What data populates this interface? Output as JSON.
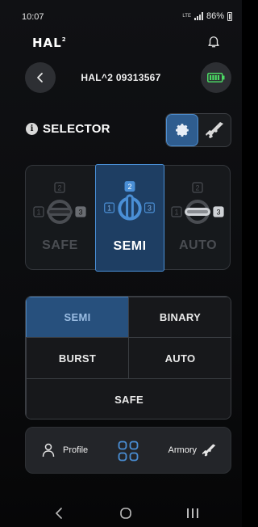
{
  "status_bar": {
    "time": "10:07",
    "network": "LTE",
    "battery": "86%"
  },
  "header": {
    "logo": "HAL",
    "logo_sup": "2"
  },
  "device": {
    "name": "HAL^2 09313567"
  },
  "selector": {
    "title": "SELECTOR",
    "positions": [
      {
        "label": "SAFE",
        "numbers": [
          "1",
          "2",
          "3"
        ],
        "active": false
      },
      {
        "label": "SEMI",
        "numbers": [
          "1",
          "2",
          "3"
        ],
        "active": true
      },
      {
        "label": "AUTO",
        "numbers": [
          "1",
          "2",
          "3"
        ],
        "active": false
      }
    ]
  },
  "fire_modes": {
    "items": [
      {
        "label": "SEMI",
        "active": true
      },
      {
        "label": "BINARY",
        "active": false
      },
      {
        "label": "BURST",
        "active": false
      },
      {
        "label": "AUTO",
        "active": false
      },
      {
        "label": "SAFE",
        "active": false
      }
    ]
  },
  "nav": {
    "profile": "Profile",
    "armory": "Armory"
  },
  "colors": {
    "accent": "#4a8fd6",
    "active_fill": "#1e3e63",
    "battery_green": "#4cd964"
  },
  "icons": [
    "bell-icon",
    "back-arrow-icon",
    "battery-icon",
    "info-icon",
    "gear-icon",
    "rifle-icon",
    "person-icon",
    "grid-icon"
  ]
}
